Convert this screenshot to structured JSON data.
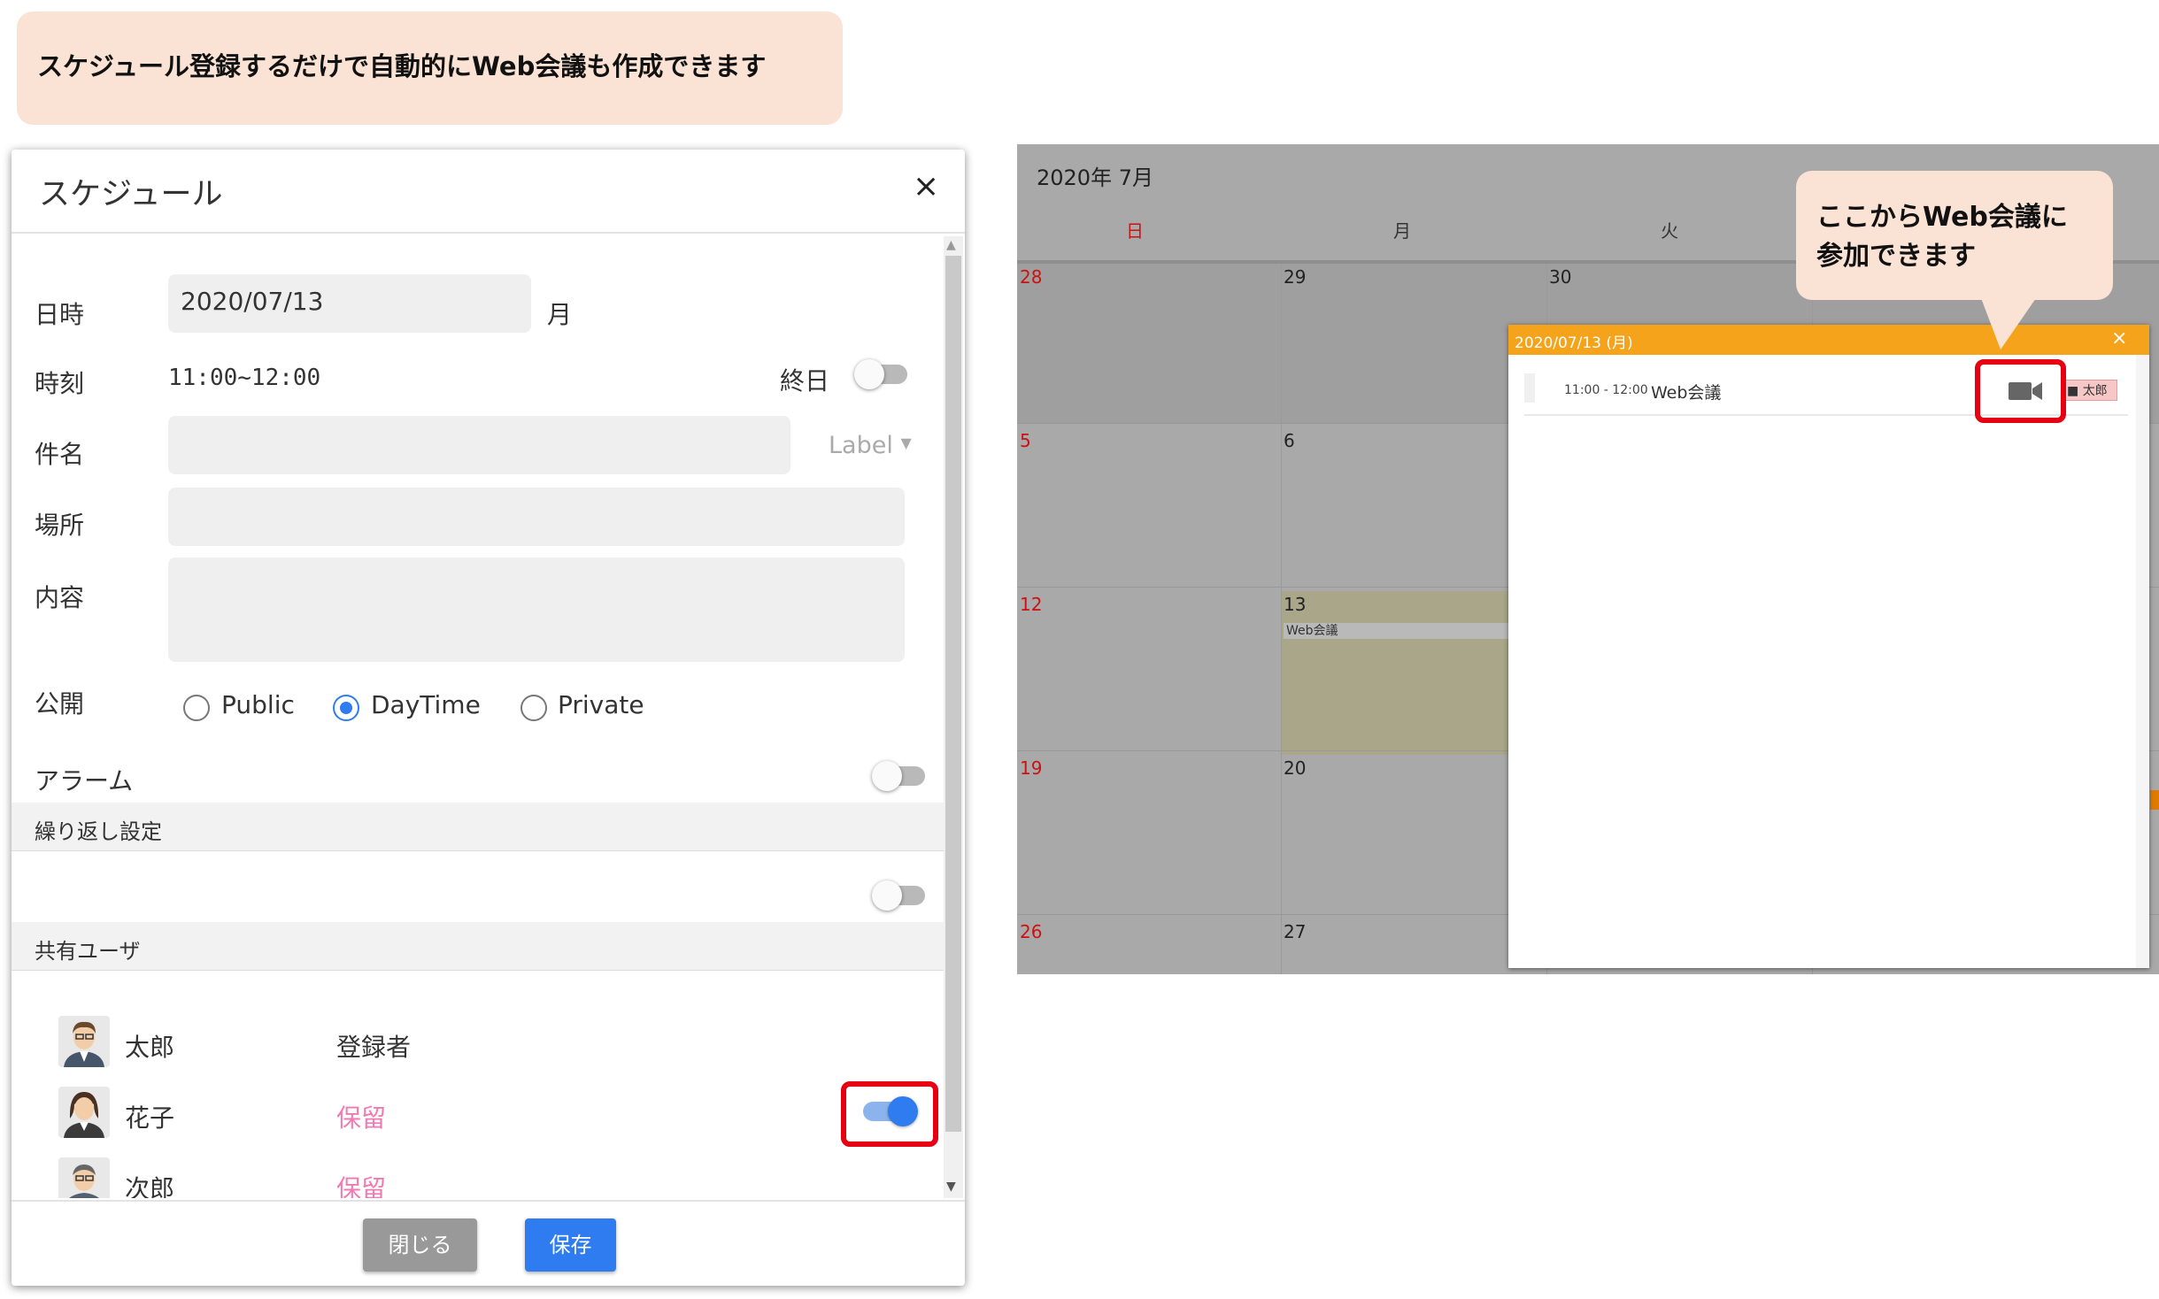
{
  "banner": {
    "text": "スケジュール登録するだけで自動的にWeb会議も作成できます"
  },
  "dialog": {
    "title": "スケジュール",
    "close_symbol": "×",
    "icons": {
      "close": "close-icon",
      "video": "video-camera-icon"
    },
    "date_label": "日時",
    "date_value": "2020/07/13",
    "weekday": "月",
    "time_label": "時刻",
    "time_value": "11:00~12:00",
    "allday_label": "終日",
    "allday_on": false,
    "subject_label": "件名",
    "subject_value": "",
    "label_dropdown": "Label",
    "place_label": "場所",
    "place_value": "",
    "content_label": "内容",
    "content_value": "",
    "visibility_label": "公開",
    "visibility_options": [
      "Public",
      "DayTime",
      "Private"
    ],
    "visibility_selected": "DayTime",
    "alarm_label": "アラーム",
    "alarm_on": false,
    "repeat_section": "繰り返し設定",
    "repeat_on": false,
    "share_section": "共有ユーザ",
    "users": [
      {
        "name": "太郎",
        "status": "登録者",
        "status_color": "#333333"
      },
      {
        "name": "花子",
        "status": "保留",
        "status_color": "#f27ab0",
        "web_meeting_on": true
      },
      {
        "name": "次郎",
        "status": "保留",
        "status_color": "#f27ab0"
      }
    ],
    "close_button": "閉じる",
    "save_button": "保存",
    "accent_color": "#2f7cf0"
  },
  "calendar": {
    "title": "2020年 7月",
    "weekdays": [
      "日",
      "月",
      "火"
    ],
    "rows": [
      {
        "dates": [
          "28",
          "29",
          "30"
        ]
      },
      {
        "dates": [
          "5",
          "6",
          ""
        ]
      },
      {
        "dates": [
          "12",
          "13",
          ""
        ]
      },
      {
        "dates": [
          "19",
          "20",
          ""
        ]
      },
      {
        "dates": [
          "26",
          "27",
          ""
        ]
      }
    ],
    "event_label": "Web会議",
    "popup": {
      "date": "2020/07/13 (月)",
      "close_symbol": "×",
      "time": "11:00 - 12:00",
      "title": "Web会議",
      "user": "太郎",
      "header_color": "#f5a31a"
    }
  },
  "callout": {
    "line1": "ここからWeb会議に",
    "line2": "参加できます"
  }
}
